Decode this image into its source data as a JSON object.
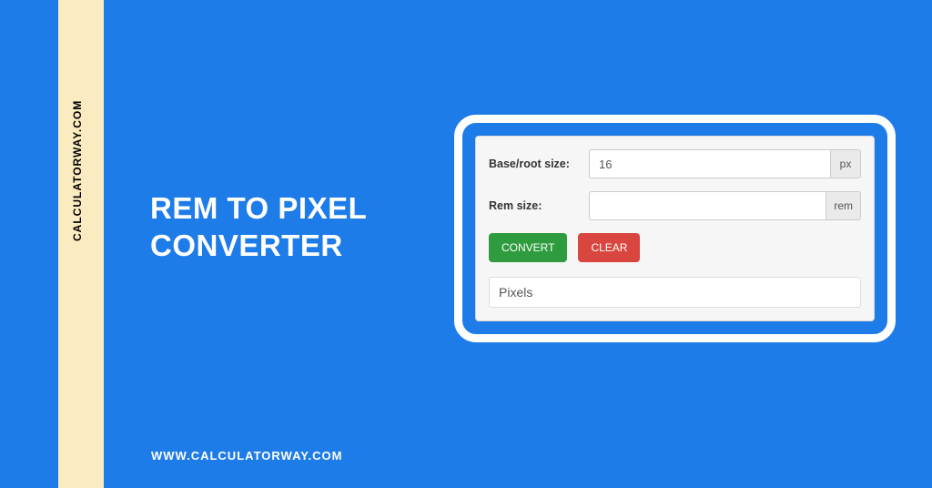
{
  "sidebar": {
    "vertical_text": "CALCULATORWAY.COM"
  },
  "title": {
    "line1": "REM TO PIXEL",
    "line2": "CONVERTER"
  },
  "footer": {
    "url": "WWW.CALCULATORWAY.COM"
  },
  "form": {
    "base_label": "Base/root size:",
    "base_value": "16",
    "base_unit": "px",
    "rem_label": "Rem size:",
    "rem_value": "",
    "rem_unit": "rem",
    "convert_label": "CONVERT",
    "clear_label": "CLEAR",
    "result_placeholder": "Pixels"
  }
}
